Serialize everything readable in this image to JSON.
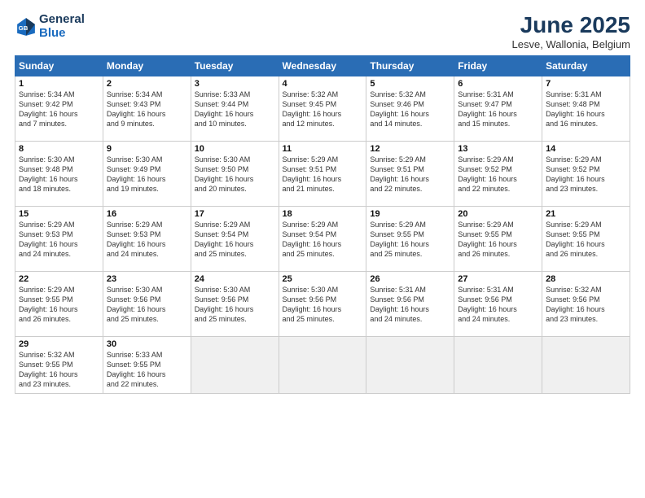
{
  "header": {
    "logo_line1": "General",
    "logo_line2": "Blue",
    "month": "June 2025",
    "location": "Lesve, Wallonia, Belgium"
  },
  "weekdays": [
    "Sunday",
    "Monday",
    "Tuesday",
    "Wednesday",
    "Thursday",
    "Friday",
    "Saturday"
  ],
  "weeks": [
    [
      {
        "day": "1",
        "info": "Sunrise: 5:34 AM\nSunset: 9:42 PM\nDaylight: 16 hours\nand 7 minutes."
      },
      {
        "day": "2",
        "info": "Sunrise: 5:34 AM\nSunset: 9:43 PM\nDaylight: 16 hours\nand 9 minutes."
      },
      {
        "day": "3",
        "info": "Sunrise: 5:33 AM\nSunset: 9:44 PM\nDaylight: 16 hours\nand 10 minutes."
      },
      {
        "day": "4",
        "info": "Sunrise: 5:32 AM\nSunset: 9:45 PM\nDaylight: 16 hours\nand 12 minutes."
      },
      {
        "day": "5",
        "info": "Sunrise: 5:32 AM\nSunset: 9:46 PM\nDaylight: 16 hours\nand 14 minutes."
      },
      {
        "day": "6",
        "info": "Sunrise: 5:31 AM\nSunset: 9:47 PM\nDaylight: 16 hours\nand 15 minutes."
      },
      {
        "day": "7",
        "info": "Sunrise: 5:31 AM\nSunset: 9:48 PM\nDaylight: 16 hours\nand 16 minutes."
      }
    ],
    [
      {
        "day": "8",
        "info": "Sunrise: 5:30 AM\nSunset: 9:48 PM\nDaylight: 16 hours\nand 18 minutes."
      },
      {
        "day": "9",
        "info": "Sunrise: 5:30 AM\nSunset: 9:49 PM\nDaylight: 16 hours\nand 19 minutes."
      },
      {
        "day": "10",
        "info": "Sunrise: 5:30 AM\nSunset: 9:50 PM\nDaylight: 16 hours\nand 20 minutes."
      },
      {
        "day": "11",
        "info": "Sunrise: 5:29 AM\nSunset: 9:51 PM\nDaylight: 16 hours\nand 21 minutes."
      },
      {
        "day": "12",
        "info": "Sunrise: 5:29 AM\nSunset: 9:51 PM\nDaylight: 16 hours\nand 22 minutes."
      },
      {
        "day": "13",
        "info": "Sunrise: 5:29 AM\nSunset: 9:52 PM\nDaylight: 16 hours\nand 22 minutes."
      },
      {
        "day": "14",
        "info": "Sunrise: 5:29 AM\nSunset: 9:52 PM\nDaylight: 16 hours\nand 23 minutes."
      }
    ],
    [
      {
        "day": "15",
        "info": "Sunrise: 5:29 AM\nSunset: 9:53 PM\nDaylight: 16 hours\nand 24 minutes."
      },
      {
        "day": "16",
        "info": "Sunrise: 5:29 AM\nSunset: 9:53 PM\nDaylight: 16 hours\nand 24 minutes."
      },
      {
        "day": "17",
        "info": "Sunrise: 5:29 AM\nSunset: 9:54 PM\nDaylight: 16 hours\nand 25 minutes."
      },
      {
        "day": "18",
        "info": "Sunrise: 5:29 AM\nSunset: 9:54 PM\nDaylight: 16 hours\nand 25 minutes."
      },
      {
        "day": "19",
        "info": "Sunrise: 5:29 AM\nSunset: 9:55 PM\nDaylight: 16 hours\nand 25 minutes."
      },
      {
        "day": "20",
        "info": "Sunrise: 5:29 AM\nSunset: 9:55 PM\nDaylight: 16 hours\nand 26 minutes."
      },
      {
        "day": "21",
        "info": "Sunrise: 5:29 AM\nSunset: 9:55 PM\nDaylight: 16 hours\nand 26 minutes."
      }
    ],
    [
      {
        "day": "22",
        "info": "Sunrise: 5:29 AM\nSunset: 9:55 PM\nDaylight: 16 hours\nand 26 minutes."
      },
      {
        "day": "23",
        "info": "Sunrise: 5:30 AM\nSunset: 9:56 PM\nDaylight: 16 hours\nand 25 minutes."
      },
      {
        "day": "24",
        "info": "Sunrise: 5:30 AM\nSunset: 9:56 PM\nDaylight: 16 hours\nand 25 minutes."
      },
      {
        "day": "25",
        "info": "Sunrise: 5:30 AM\nSunset: 9:56 PM\nDaylight: 16 hours\nand 25 minutes."
      },
      {
        "day": "26",
        "info": "Sunrise: 5:31 AM\nSunset: 9:56 PM\nDaylight: 16 hours\nand 24 minutes."
      },
      {
        "day": "27",
        "info": "Sunrise: 5:31 AM\nSunset: 9:56 PM\nDaylight: 16 hours\nand 24 minutes."
      },
      {
        "day": "28",
        "info": "Sunrise: 5:32 AM\nSunset: 9:56 PM\nDaylight: 16 hours\nand 23 minutes."
      }
    ],
    [
      {
        "day": "29",
        "info": "Sunrise: 5:32 AM\nSunset: 9:55 PM\nDaylight: 16 hours\nand 23 minutes."
      },
      {
        "day": "30",
        "info": "Sunrise: 5:33 AM\nSunset: 9:55 PM\nDaylight: 16 hours\nand 22 minutes."
      },
      {
        "day": "",
        "info": ""
      },
      {
        "day": "",
        "info": ""
      },
      {
        "day": "",
        "info": ""
      },
      {
        "day": "",
        "info": ""
      },
      {
        "day": "",
        "info": ""
      }
    ]
  ]
}
